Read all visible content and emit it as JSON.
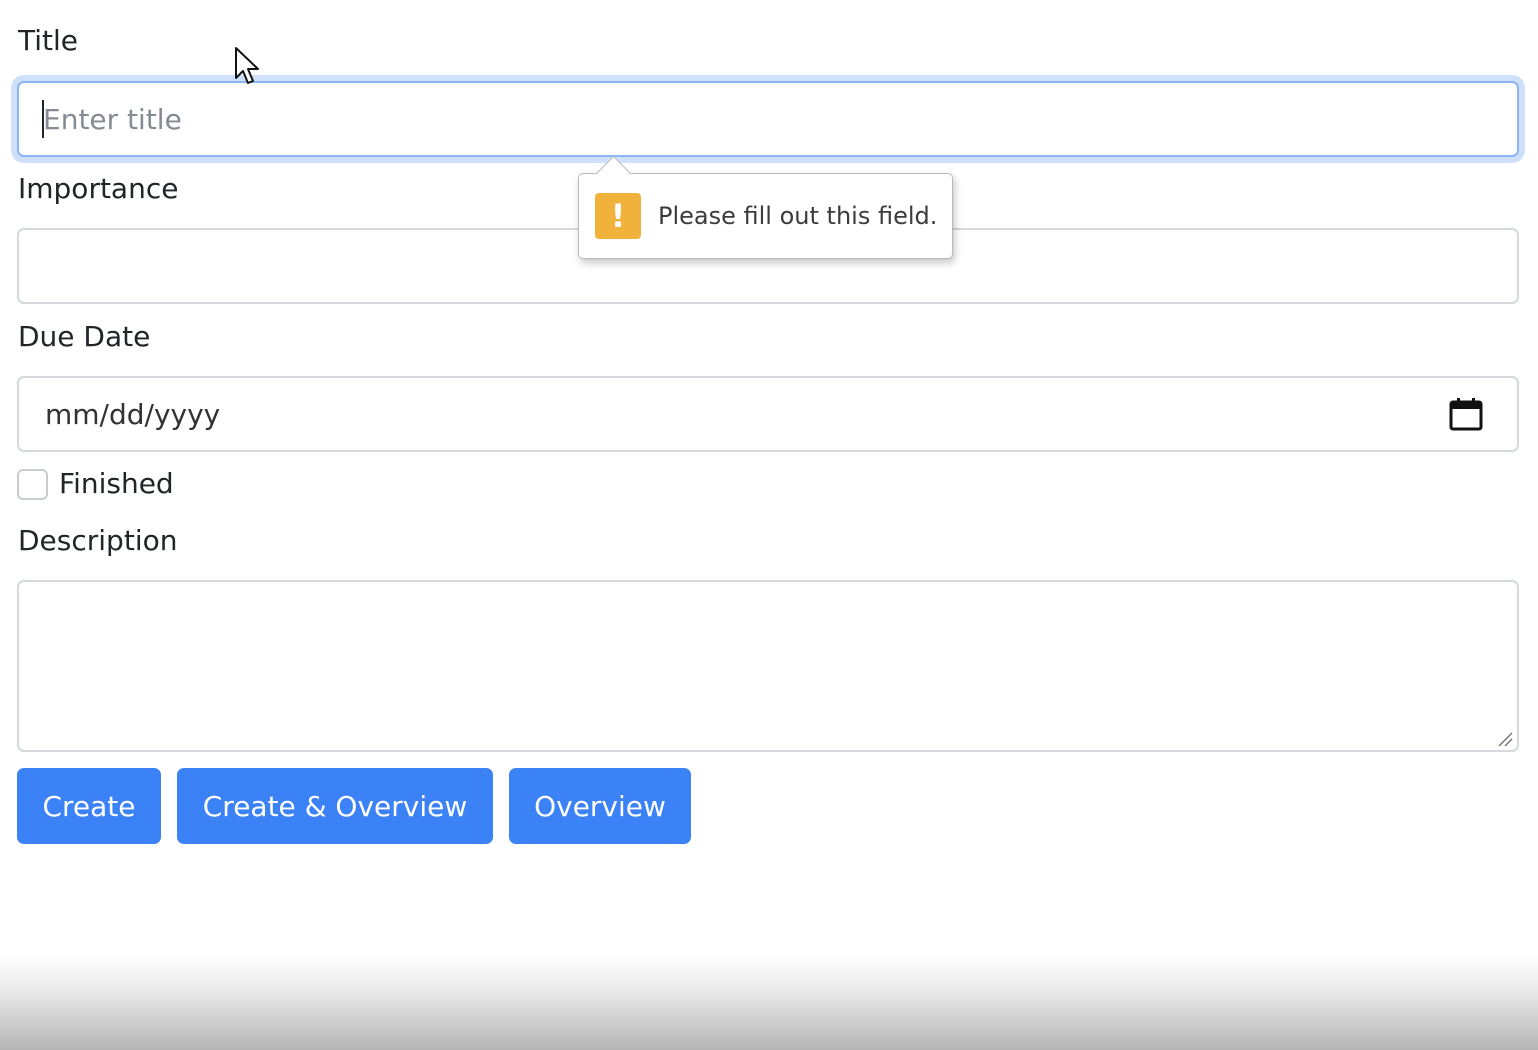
{
  "form": {
    "title_label": "Title",
    "title_placeholder": "Enter title",
    "title_value": "",
    "importance_label": "Importance",
    "importance_value": "",
    "due_date_label": "Due Date",
    "due_date_placeholder": "mm/dd/yyyy",
    "finished_label": "Finished",
    "finished_checked": false,
    "description_label": "Description",
    "description_value": ""
  },
  "buttons": {
    "create": "Create",
    "create_overview": "Create & Overview",
    "overview": "Overview"
  },
  "validation": {
    "message": "Please fill out this field.",
    "icon": "warning-exclamation-icon",
    "icon_color": "#f0b23a"
  },
  "colors": {
    "primary": "#3b82f6",
    "focus_ring": "#8bb5f4"
  }
}
